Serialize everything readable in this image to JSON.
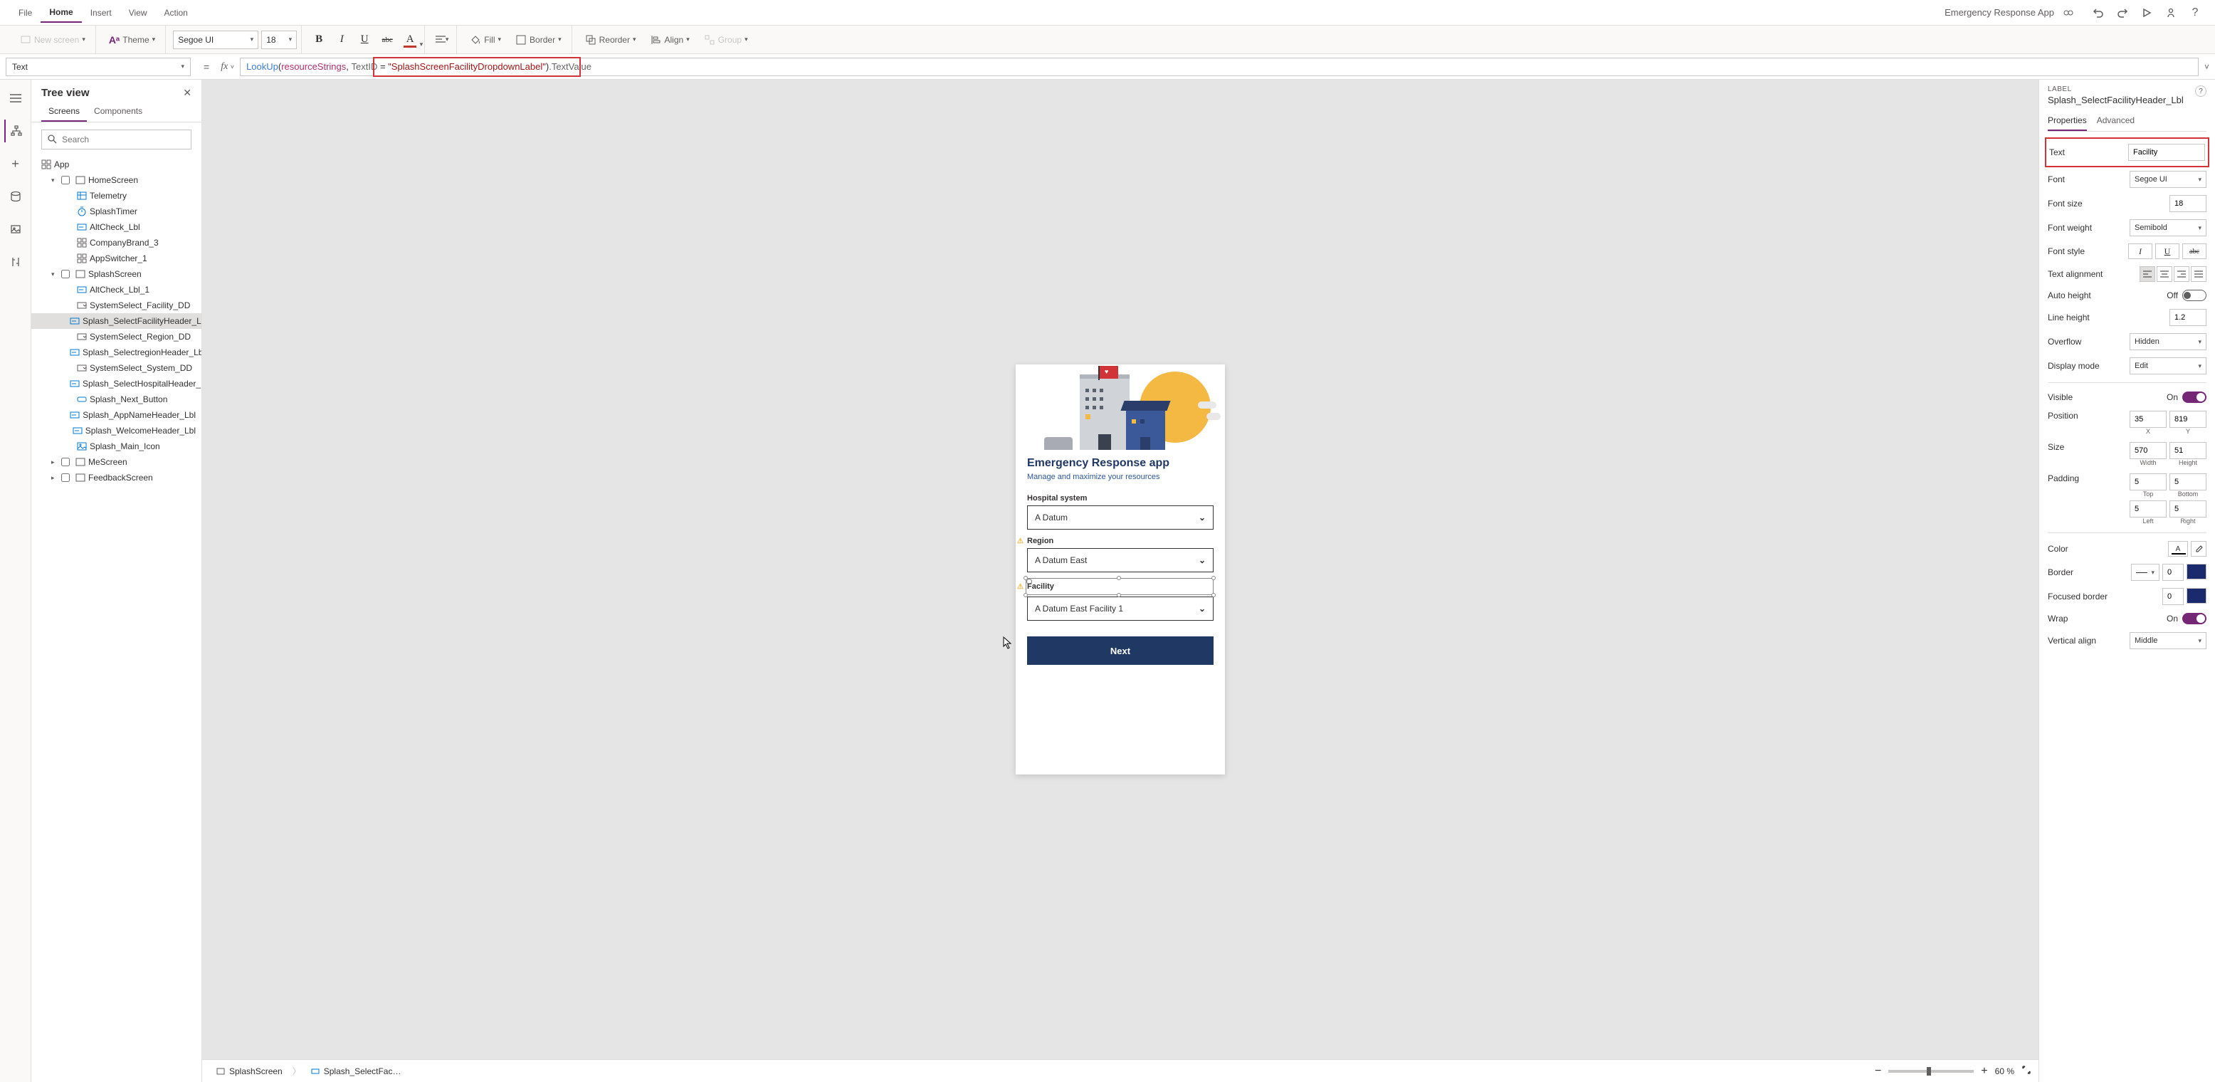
{
  "menubar": {
    "items": [
      "File",
      "Home",
      "Insert",
      "View",
      "Action"
    ],
    "active": "Home",
    "app_title": "Emergency Response App"
  },
  "toolbar": {
    "new_screen": "New screen",
    "theme": "Theme",
    "font_family": "Segoe UI",
    "font_size": "18",
    "fill": "Fill",
    "border": "Border",
    "reorder": "Reorder",
    "align": "Align",
    "group": "Group"
  },
  "formula": {
    "property": "Text",
    "fn": "LookUp",
    "id": "resourceStrings",
    "col": "TextID",
    "str": "\"SplashScreenFacilityDropdownLabel\"",
    "tail": ".TextValue"
  },
  "tree": {
    "title": "Tree view",
    "tabs": [
      "Screens",
      "Components"
    ],
    "search_ph": "Search",
    "root": "App",
    "items": [
      {
        "depth": 1,
        "icon": "screen",
        "label": "HomeScreen",
        "caret": "open"
      },
      {
        "depth": 2,
        "icon": "table",
        "label": "Telemetry"
      },
      {
        "depth": 2,
        "icon": "timer",
        "label": "SplashTimer"
      },
      {
        "depth": 2,
        "icon": "label",
        "label": "AltCheck_Lbl"
      },
      {
        "depth": 2,
        "icon": "group",
        "label": "CompanyBrand_3"
      },
      {
        "depth": 2,
        "icon": "group",
        "label": "AppSwitcher_1"
      },
      {
        "depth": 1,
        "icon": "screen",
        "label": "SplashScreen",
        "caret": "open"
      },
      {
        "depth": 2,
        "icon": "label",
        "label": "AltCheck_Lbl_1"
      },
      {
        "depth": 2,
        "icon": "dd",
        "label": "SystemSelect_Facility_DD"
      },
      {
        "depth": 2,
        "icon": "label",
        "label": "Splash_SelectFacilityHeader_Lbl",
        "selected": true
      },
      {
        "depth": 2,
        "icon": "dd",
        "label": "SystemSelect_Region_DD"
      },
      {
        "depth": 2,
        "icon": "label",
        "label": "Splash_SelectregionHeader_Lbl"
      },
      {
        "depth": 2,
        "icon": "dd",
        "label": "SystemSelect_System_DD"
      },
      {
        "depth": 2,
        "icon": "label",
        "label": "Splash_SelectHospitalHeader_Lbl"
      },
      {
        "depth": 2,
        "icon": "button",
        "label": "Splash_Next_Button"
      },
      {
        "depth": 2,
        "icon": "label",
        "label": "Splash_AppNameHeader_Lbl"
      },
      {
        "depth": 2,
        "icon": "label",
        "label": "Splash_WelcomeHeader_Lbl"
      },
      {
        "depth": 2,
        "icon": "image",
        "label": "Splash_Main_Icon"
      },
      {
        "depth": 1,
        "icon": "screen",
        "label": "MeScreen",
        "caret": "closed"
      },
      {
        "depth": 1,
        "icon": "screen",
        "label": "FeedbackScreen",
        "caret": "closed"
      }
    ]
  },
  "canvas": {
    "app_title": "Emergency Response app",
    "app_subtitle": "Manage and maximize your resources",
    "fields": {
      "hospital_label": "Hospital system",
      "hospital_value": "A Datum",
      "region_label": "Region",
      "region_value": "A Datum East",
      "facility_label": "Facility",
      "facility_value": "A Datum East Facility 1"
    },
    "next_button": "Next"
  },
  "breadcrumb": {
    "screen": "SplashScreen",
    "element": "Splash_SelectFac…"
  },
  "zoom": "60 %",
  "props": {
    "kind": "LABEL",
    "name": "Splash_SelectFacilityHeader_Lbl",
    "tabs": [
      "Properties",
      "Advanced"
    ],
    "text": {
      "label": "Text",
      "value": "Facility"
    },
    "font": {
      "label": "Font",
      "value": "Segoe UI"
    },
    "font_size": {
      "label": "Font size",
      "value": "18"
    },
    "font_weight": {
      "label": "Font weight",
      "value": "Semibold"
    },
    "font_style": {
      "label": "Font style"
    },
    "text_align": {
      "label": "Text alignment"
    },
    "auto_height": {
      "label": "Auto height",
      "value": "Off"
    },
    "line_height": {
      "label": "Line height",
      "value": "1.2"
    },
    "overflow": {
      "label": "Overflow",
      "value": "Hidden"
    },
    "display_mode": {
      "label": "Display mode",
      "value": "Edit"
    },
    "visible": {
      "label": "Visible",
      "value": "On"
    },
    "position": {
      "label": "Position",
      "x": "35",
      "y": "819",
      "xl": "X",
      "yl": "Y"
    },
    "size": {
      "label": "Size",
      "w": "570",
      "h": "51",
      "wl": "Width",
      "hl": "Height"
    },
    "padding": {
      "label": "Padding",
      "t": "5",
      "b": "5",
      "l": "5",
      "r": "5",
      "tl": "Top",
      "bl": "Bottom",
      "ll": "Left",
      "rl": "Right"
    },
    "color": {
      "label": "Color"
    },
    "border": {
      "label": "Border",
      "value": "0"
    },
    "focused_border": {
      "label": "Focused border",
      "value": "0"
    },
    "wrap": {
      "label": "Wrap",
      "value": "On"
    },
    "valign": {
      "label": "Vertical align",
      "value": "Middle"
    }
  }
}
